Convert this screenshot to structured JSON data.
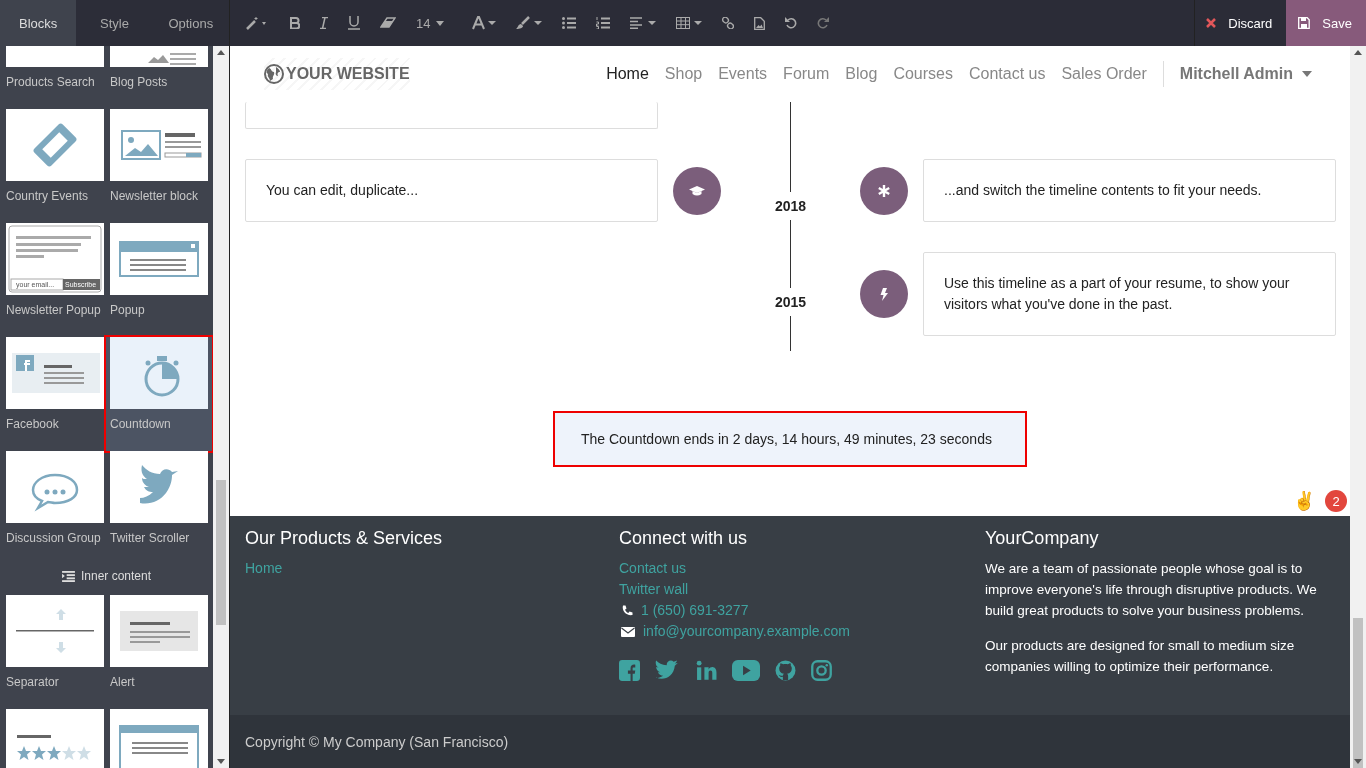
{
  "sidebar": {
    "tabs": [
      {
        "label": "Blocks",
        "selected": true
      },
      {
        "label": "Style",
        "selected": false
      },
      {
        "label": "Options",
        "selected": false
      }
    ],
    "sections": [
      {
        "items": [
          {
            "label": "Products Search",
            "selected": false
          },
          {
            "label": "Blog Posts",
            "selected": false
          },
          {
            "label": "Country Events",
            "selected": false
          },
          {
            "label": "Newsletter block",
            "selected": false
          },
          {
            "label": "Newsletter Popup",
            "selected": false,
            "thumbnail_texts": [
              "your email...",
              "Subscribe"
            ]
          },
          {
            "label": "Popup",
            "selected": false
          },
          {
            "label": "Facebook",
            "selected": false
          },
          {
            "label": "Countdown",
            "selected": true
          },
          {
            "label": "Discussion Group",
            "selected": false
          },
          {
            "label": "Twitter Scroller",
            "selected": false
          }
        ]
      },
      {
        "heading": "Inner content",
        "items": [
          {
            "label": "Separator",
            "selected": false
          },
          {
            "label": "Alert",
            "selected": false
          },
          {
            "selected": false
          },
          {
            "selected": false
          }
        ]
      }
    ]
  },
  "toolbar": {
    "font_size": "14",
    "discard": "Discard",
    "save": "Save"
  },
  "navbar": {
    "brand": "YOUR WEBSITE",
    "items": [
      {
        "label": "Home",
        "selected": true
      },
      {
        "label": "Shop",
        "selected": false
      },
      {
        "label": "Events",
        "selected": false
      },
      {
        "label": "Forum",
        "selected": false
      },
      {
        "label": "Blog",
        "selected": false
      },
      {
        "label": "Courses",
        "selected": false
      },
      {
        "label": "Contact us",
        "selected": false
      },
      {
        "label": "Sales Order",
        "selected": false
      }
    ],
    "user": "Mitchell Admin"
  },
  "timeline": [
    {
      "year": "2018",
      "left": "You can edit, duplicate...",
      "right": "...and switch the timeline contents to fit your needs."
    },
    {
      "year": "2015",
      "right": "Use this timeline as a part of your resume, to show your visitors what you've done in the past."
    }
  ],
  "countdown": {
    "text": "The Countdown ends in 2 days, 14 hours, 49 minutes, 23 seconds",
    "selected": true
  },
  "notification": {
    "emoji": "✌",
    "badge": "2"
  },
  "footer": {
    "columns": [
      {
        "title": "Our Products & Services",
        "links": [
          "Home"
        ]
      },
      {
        "title": "Connect with us",
        "links": [
          "Contact us",
          "Twitter wall"
        ],
        "phone": "1 (650) 691-3277",
        "email": "info@yourcompany.example.com"
      },
      {
        "title": "YourCompany",
        "paragraphs": [
          "We are a team of passionate people whose goal is to improve everyone's life through disruptive products. We build great products to solve your business problems.",
          "Our products are designed for small to medium size companies willing to optimize their performance."
        ]
      }
    ],
    "copyright": "Copyright © My Company (San Francisco)"
  }
}
